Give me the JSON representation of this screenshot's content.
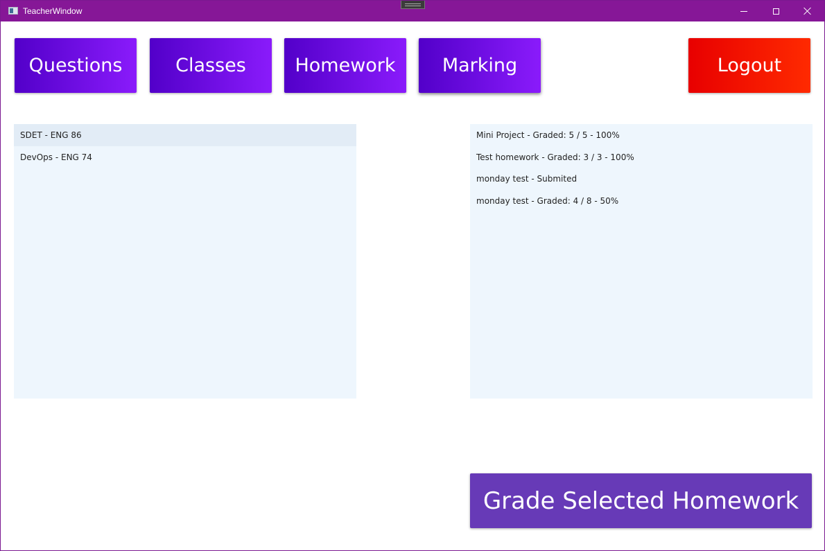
{
  "window": {
    "title": "TeacherWindow"
  },
  "nav": {
    "questions_label": "Questions",
    "classes_label": "Classes",
    "homework_label": "Homework",
    "marking_label": "Marking",
    "logout_label": "Logout"
  },
  "classes": [
    {
      "label": "SDET - ENG 86",
      "selected": true
    },
    {
      "label": "DevOps - ENG 74",
      "selected": false
    }
  ],
  "homework": [
    {
      "label": "Mini Project - Graded: 5 / 5 - 100%"
    },
    {
      "label": "Test homework - Graded: 3 / 3 - 100%"
    },
    {
      "label": "monday test - Submited"
    },
    {
      "label": "monday test - Graded: 4 / 8 - 50%"
    }
  ],
  "actions": {
    "grade_label": "Grade Selected Homework"
  },
  "colors": {
    "titlebar": "#861797",
    "nav_gradient_start": "#5200c9",
    "nav_gradient_end": "#8a1bfb",
    "logout_start": "#e80000",
    "logout_end": "#ff2a00",
    "grade_button": "#673ab7",
    "list_bg": "#eef6fd"
  }
}
